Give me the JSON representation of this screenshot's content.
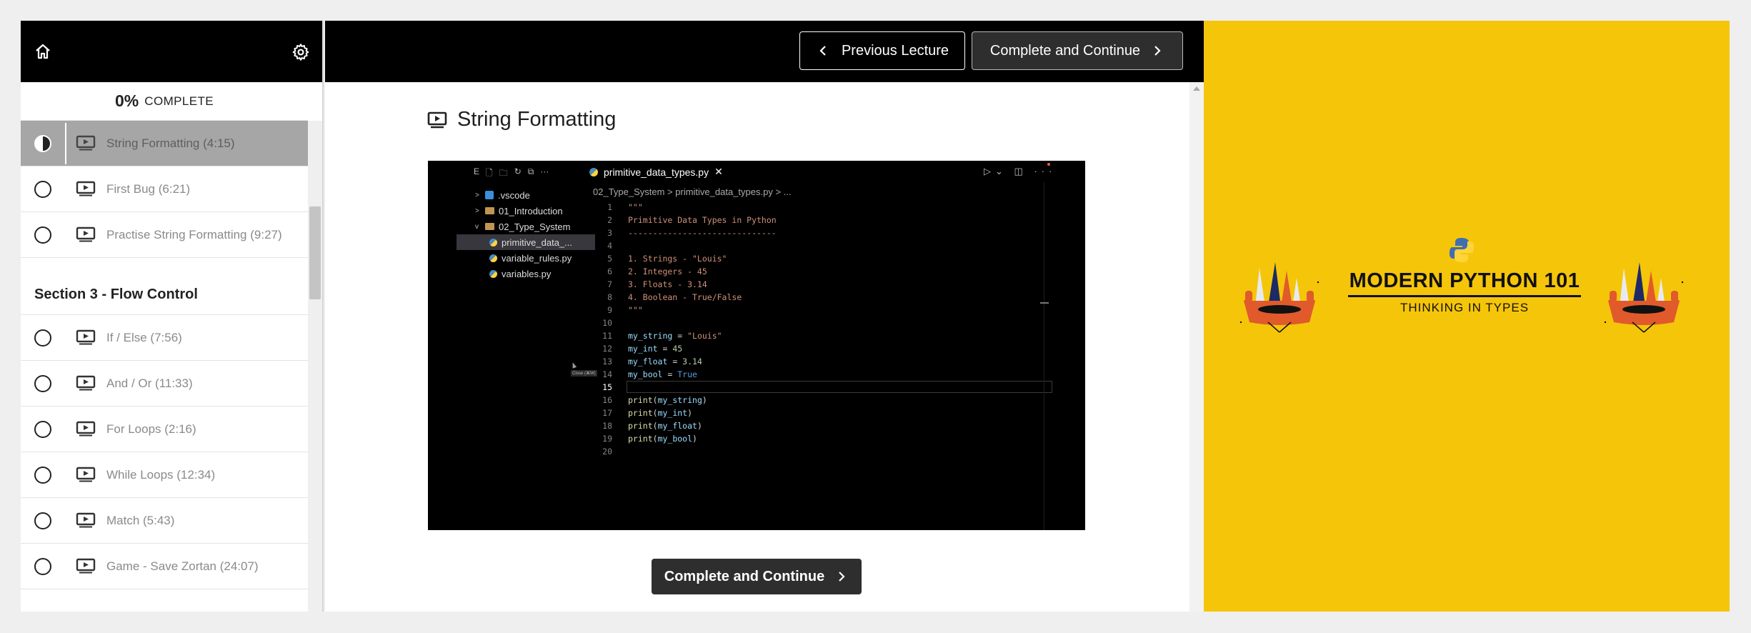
{
  "sidebar": {
    "progress_percent": "0%",
    "progress_label": "COMPLETE",
    "lectures_top": [
      {
        "title": "String Formatting (4:15)",
        "state": "current"
      },
      {
        "title": "First Bug (6:21)",
        "state": "incomplete"
      },
      {
        "title": "Practise String Formatting (9:27)",
        "state": "incomplete"
      }
    ],
    "section_title": "Section 3 - Flow Control",
    "lectures_section": [
      {
        "title": "If / Else (7:56)"
      },
      {
        "title": "And / Or (11:33)"
      },
      {
        "title": "For Loops (2:16)"
      },
      {
        "title": "While Loops (12:34)"
      },
      {
        "title": "Match (5:43)"
      },
      {
        "title": "Game - Save Zortan (24:07)"
      }
    ]
  },
  "topbar": {
    "previous_label": "Previous Lecture",
    "next_label": "Complete and Continue"
  },
  "main": {
    "lecture_title": "String Formatting",
    "complete_label": "Complete and Continue"
  },
  "video": {
    "tab_filename": "primitive_data_types.py",
    "toolbar_letter": "E",
    "breadcrumb": "02_Type_System  >  primitive_data_types.py  >  ...",
    "tree": [
      {
        "label": ".vscode",
        "kind": "vscode",
        "caret": ">"
      },
      {
        "label": "01_Introduction",
        "kind": "folder",
        "caret": ">"
      },
      {
        "label": "02_Type_System",
        "kind": "folder",
        "caret": "v"
      },
      {
        "label": "primitive_data_...",
        "kind": "py",
        "caret": ""
      },
      {
        "label": "variable_rules.py",
        "kind": "py",
        "caret": ""
      },
      {
        "label": "variables.py",
        "kind": "py",
        "caret": ""
      }
    ],
    "tooltip": "Close (⌘W)",
    "line_numbers": [
      "1",
      "2",
      "3",
      "4",
      "5",
      "6",
      "7",
      "8",
      "9",
      "10",
      "11",
      "12",
      "13",
      "14",
      "15",
      "16",
      "17",
      "18",
      "19",
      "20"
    ],
    "code": {
      "l1": "\"\"\"",
      "l2": "Primitive Data Types in Python",
      "l3": "------------------------------",
      "l5": "1. Strings - \"Louis\"",
      "l6": "2. Integers - 45",
      "l7": "3. Floats - 3.14",
      "l8": "4. Boolean - True/False",
      "l9": "\"\"\"",
      "l11_var": "my_string",
      "l11_val": "\"Louis\"",
      "l12_var": "my_int",
      "l12_val": "45",
      "l13_var": "my_float",
      "l13_val": "3.14",
      "l14_var": "my_bool",
      "l14_val": "True",
      "eq": " = ",
      "fn": "print",
      "l16_arg": "my_string",
      "l17_arg": "my_int",
      "l18_arg": "my_float",
      "l19_arg": "my_bool"
    }
  },
  "banner": {
    "title": "MODERN PYTHON 101",
    "subtitle": "THINKING IN TYPES",
    "background": "#f5c50a"
  },
  "icons": {
    "home": "home-icon",
    "settings": "gear-icon",
    "video": "video-lecture-icon",
    "chevron_left": "chevron-left-icon",
    "chevron_right": "chevron-right-icon"
  }
}
